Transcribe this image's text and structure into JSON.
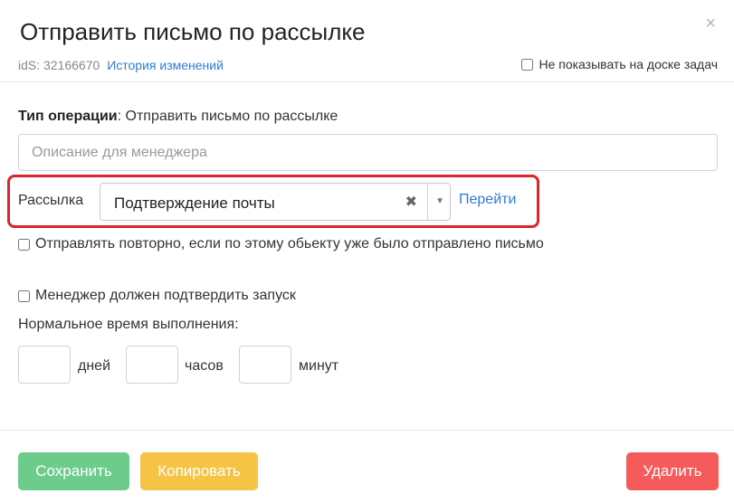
{
  "header": {
    "title": "Отправить письмо по рассылке",
    "close_icon": "×",
    "id_text": "idS: 32166670",
    "history_link": "История изменений",
    "hide_board_label": "Не показывать на доске задач"
  },
  "form": {
    "operation_type_label": "Тип операции",
    "operation_type_value": ": Отправить письмо по рассылке",
    "description_placeholder": "Описание для менеджера",
    "mailing_label": "Рассылка",
    "mailing_value": "Подтверждение почты",
    "clear_icon": "✖",
    "arrow_icon": "▼",
    "goto_link": "Перейти",
    "resend_label": "Отправлять повторно, если по этому обьекту уже было отправлено письмо",
    "manager_confirm_label": "Менеджер должен подтвердить запуск",
    "normal_time_label": "Нормальное время выполнения:",
    "days_label": "дней",
    "hours_label": "часов",
    "minutes_label": "минут"
  },
  "footer": {
    "save_label": "Сохранить",
    "copy_label": "Копировать",
    "delete_label": "Удалить"
  },
  "colors": {
    "save": "#6dcc8c",
    "copy": "#f5c445",
    "delete": "#f55b5b",
    "link": "#2f7bd3",
    "highlight": "#d9262c"
  }
}
